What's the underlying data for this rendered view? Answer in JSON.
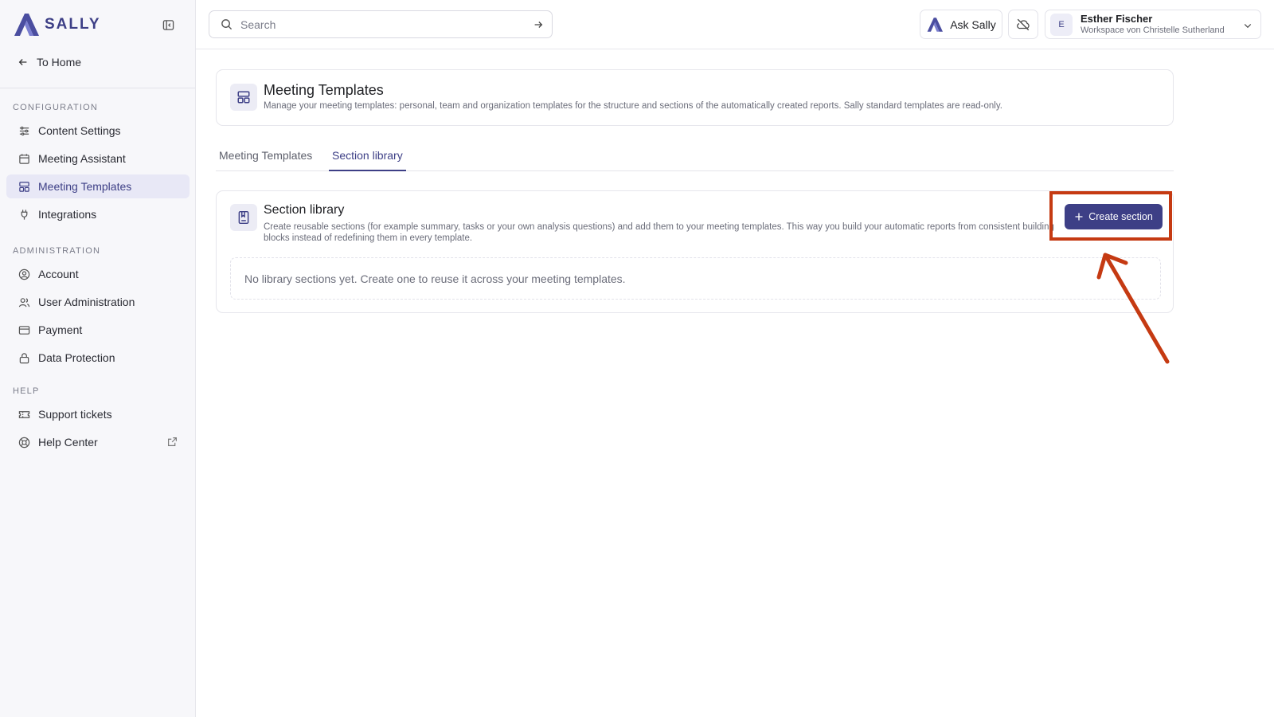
{
  "brand": {
    "name": "SALLY",
    "color": "#3d3f86"
  },
  "sidebar": {
    "home_label": "To Home",
    "sections": [
      {
        "heading": "CONFIGURATION",
        "items": [
          {
            "label": "Content Settings",
            "icon": "sliders-icon",
            "active": false
          },
          {
            "label": "Meeting Assistant",
            "icon": "calendar-icon",
            "active": false
          },
          {
            "label": "Meeting Templates",
            "icon": "layout-template-icon",
            "active": true
          },
          {
            "label": "Integrations",
            "icon": "plug-icon",
            "active": false
          }
        ]
      },
      {
        "heading": "ADMINISTRATION",
        "items": [
          {
            "label": "Account",
            "icon": "user-circle-icon",
            "active": false
          },
          {
            "label": "User Administration",
            "icon": "users-icon",
            "active": false
          },
          {
            "label": "Payment",
            "icon": "credit-card-icon",
            "active": false
          },
          {
            "label": "Data Protection",
            "icon": "lock-icon",
            "active": false
          }
        ]
      },
      {
        "heading": "HELP",
        "items": [
          {
            "label": "Support tickets",
            "icon": "ticket-icon",
            "active": false
          },
          {
            "label": "Help Center",
            "icon": "life-buoy-icon",
            "active": false,
            "external": true
          }
        ]
      }
    ]
  },
  "topbar": {
    "search_placeholder": "Search",
    "ask_label": "Ask Sally",
    "user": {
      "initial": "E",
      "name": "Esther Fischer",
      "workspace": "Workspace von Christelle Sutherland"
    }
  },
  "header": {
    "title": "Meeting Templates",
    "description": "Manage your meeting templates: personal, team and organization templates for the structure and sections of the automatically created reports. Sally standard templates are read-only."
  },
  "tabs": [
    {
      "label": "Meeting Templates",
      "active": false
    },
    {
      "label": "Section library",
      "active": true
    }
  ],
  "section_library": {
    "title": "Section library",
    "description": "Create reusable sections (for example summary, tasks or your own analysis questions) and add them to your meeting templates. This way you build your automatic reports from consistent building blocks instead of redefining them in every template.",
    "create_label": "Create section",
    "empty_message": "No library sections yet. Create one to reuse it across your meeting templates."
  },
  "annotation": {
    "color": "#c53a12"
  }
}
